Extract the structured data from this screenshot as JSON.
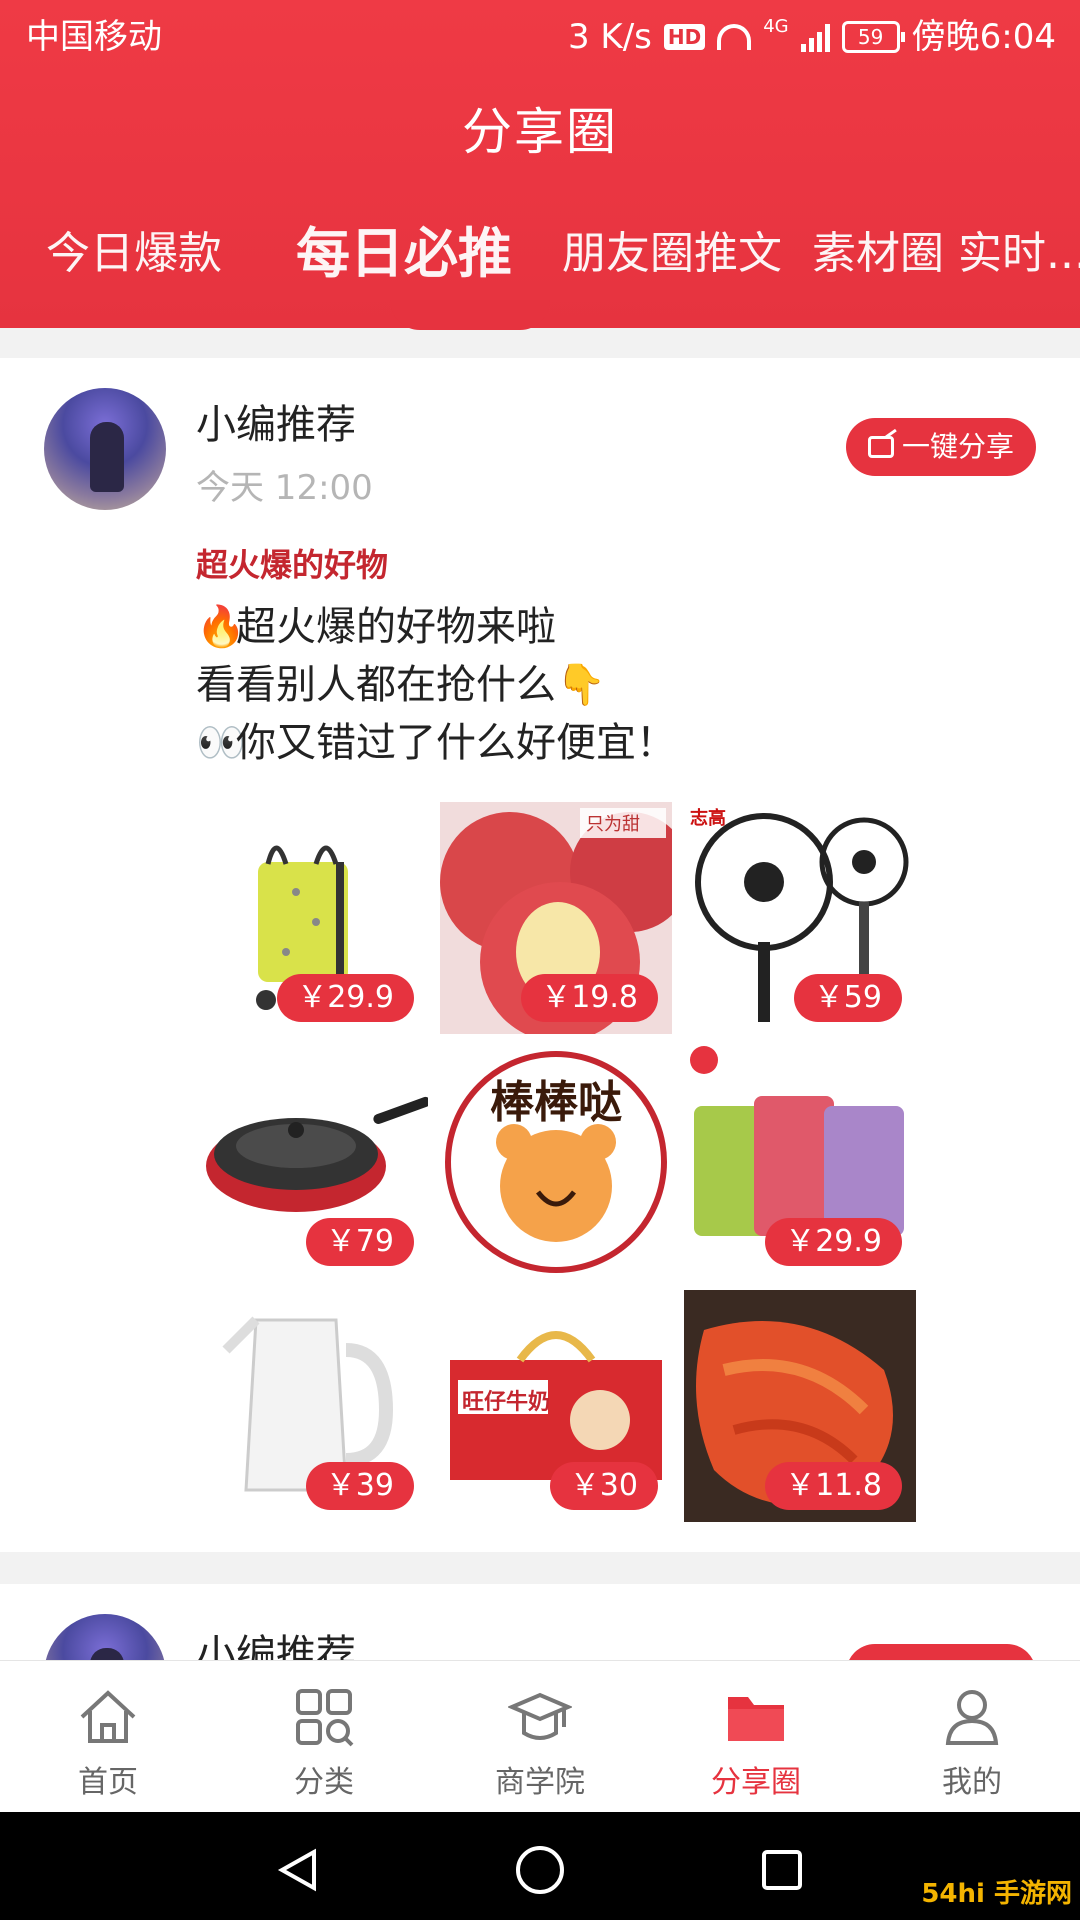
{
  "status_bar": {
    "carrier": "中国移动",
    "speed": "3 K/s",
    "hd": "HD",
    "network": "4G",
    "battery": "59",
    "time": "傍晚6:04"
  },
  "header": {
    "title": "分享圈",
    "tabs": [
      "今日爆款",
      "每日必推",
      "朋友圈推文",
      "素材圈",
      "实时..."
    ],
    "active_tab": "每日必推"
  },
  "posts": [
    {
      "author": "小编推荐",
      "time": "今天 12:00",
      "share_label": "一键分享",
      "title": "超火爆的好物",
      "lines": [
        "超火爆的好物来啦",
        "看看别人都在抢什么",
        "你又错过了什么好便宜！"
      ],
      "line_emojis": [
        "🔥",
        "👇",
        "👀"
      ],
      "products": [
        {
          "name": "shopping-trolley-bag",
          "price": "￥29.9"
        },
        {
          "name": "apple",
          "price": "￥19.8",
          "brand": "只为甜"
        },
        {
          "name": "electric-fan",
          "price": "￥59",
          "brand": "志高"
        },
        {
          "name": "wok-pan",
          "price": "￥79"
        },
        {
          "name": "sticker-bangbangda",
          "caption": "棒棒哒"
        },
        {
          "name": "snack-bags",
          "price": "￥29.9"
        },
        {
          "name": "electric-kettle",
          "price": "￥39"
        },
        {
          "name": "milk-box",
          "price": "￥30",
          "brand": "旺仔牛奶"
        },
        {
          "name": "spicy-food",
          "price": "￥11.8"
        }
      ]
    },
    {
      "author": "小编推荐"
    }
  ],
  "bottom_nav": {
    "items": [
      {
        "label": "首页",
        "icon": "home-icon"
      },
      {
        "label": "分类",
        "icon": "category-icon"
      },
      {
        "label": "商学院",
        "icon": "academy-icon"
      },
      {
        "label": "分享圈",
        "icon": "folder-icon"
      },
      {
        "label": "我的",
        "icon": "user-icon"
      }
    ],
    "active": "分享圈"
  },
  "watermark": "54hi 手游网",
  "colors": {
    "accent": "#e6333f",
    "title_red": "#c4262f"
  }
}
